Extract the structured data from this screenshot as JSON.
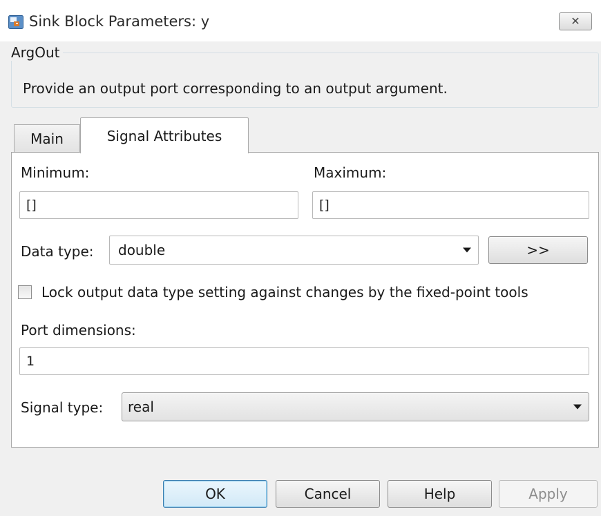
{
  "window": {
    "title": "Sink Block Parameters: y",
    "close_glyph": "✕"
  },
  "description": {
    "block_type": "ArgOut",
    "text": "Provide an output port corresponding to an output argument."
  },
  "tabs": [
    {
      "label": "Main",
      "selected": false
    },
    {
      "label": "Signal Attributes",
      "selected": true
    }
  ],
  "signal_attributes": {
    "minimum_label": "Minimum:",
    "minimum_value": "[]",
    "maximum_label": "Maximum:",
    "maximum_value": "[]",
    "data_type_label": "Data type:",
    "data_type_value": "double",
    "data_type_assistant_label": ">>",
    "lock_checkbox_label": "Lock output data type setting against changes by the fixed-point tools",
    "lock_checked": false,
    "port_dimensions_label": "Port dimensions:",
    "port_dimensions_value": "1",
    "signal_type_label": "Signal type:",
    "signal_type_value": "real"
  },
  "buttons": {
    "ok": "OK",
    "cancel": "Cancel",
    "help": "Help",
    "apply": "Apply"
  },
  "colors": {
    "dialog_background": "#f0f0f0",
    "ok_button_border": "#3c7fb1",
    "disabled_text": "#8d8d8d"
  }
}
